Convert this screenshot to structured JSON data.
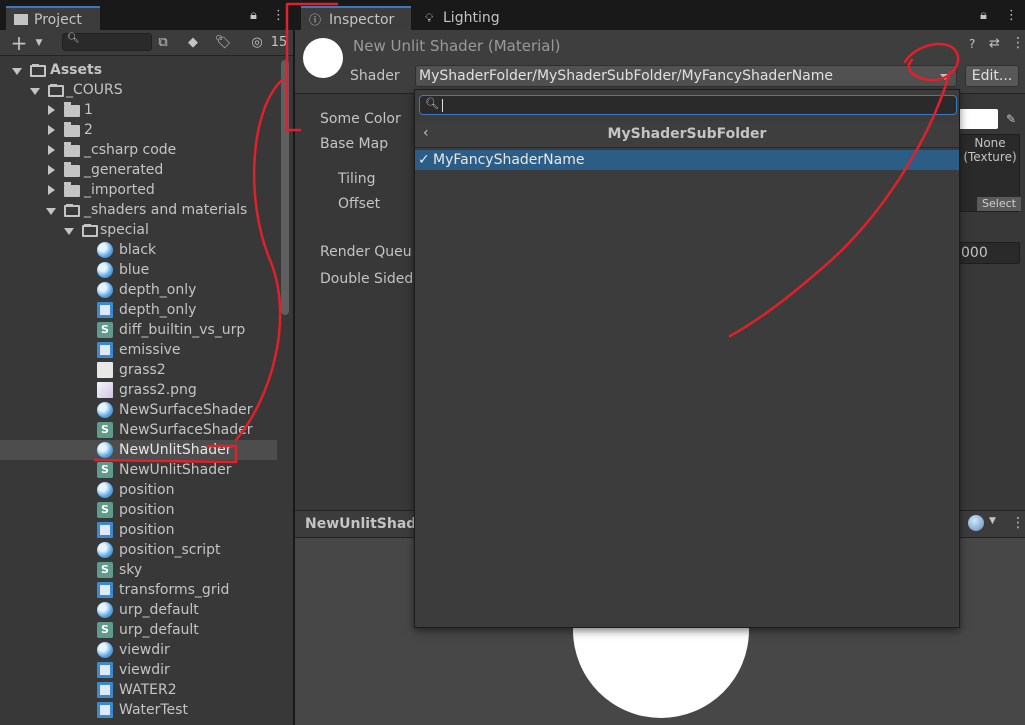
{
  "project_panel": {
    "tab_label": "Project",
    "search_placeholder": "",
    "hidden_count": "15",
    "tree": [
      {
        "label": "Assets",
        "icon": "folder-open-icon"
      },
      {
        "label": "_COURS",
        "icon": "folder-open-icon"
      },
      {
        "label": "1",
        "icon": "folder-icon"
      },
      {
        "label": "2",
        "icon": "folder-icon"
      },
      {
        "label": "_csharp code",
        "icon": "folder-icon"
      },
      {
        "label": "_generated",
        "icon": "folder-icon"
      },
      {
        "label": "_imported",
        "icon": "folder-icon"
      },
      {
        "label": "_shaders and materials",
        "icon": "folder-open-icon"
      },
      {
        "label": "special",
        "icon": "folder-open-icon"
      },
      {
        "label": "black",
        "icon": "material-icon"
      },
      {
        "label": "blue",
        "icon": "material-icon"
      },
      {
        "label": "depth_only",
        "icon": "material-icon"
      },
      {
        "label": "depth_only",
        "icon": "shader-graph-icon"
      },
      {
        "label": "diff_builtin_vs_urp",
        "icon": "shader-icon"
      },
      {
        "label": "emissive",
        "icon": "shader-graph-icon"
      },
      {
        "label": "grass2",
        "icon": "texture-icon"
      },
      {
        "label": "grass2.png",
        "icon": "texture-icon"
      },
      {
        "label": "NewSurfaceShader",
        "icon": "material-icon"
      },
      {
        "label": "NewSurfaceShader",
        "icon": "shader-icon"
      },
      {
        "label": "NewUnlitShader",
        "icon": "material-icon"
      },
      {
        "label": "NewUnlitShader",
        "icon": "shader-icon"
      },
      {
        "label": "position",
        "icon": "material-icon"
      },
      {
        "label": "position",
        "icon": "shader-icon"
      },
      {
        "label": "position",
        "icon": "shader-graph-icon"
      },
      {
        "label": "position_script",
        "icon": "material-icon"
      },
      {
        "label": "sky",
        "icon": "shader-icon"
      },
      {
        "label": "transforms_grid",
        "icon": "shader-graph-icon"
      },
      {
        "label": "urp_default",
        "icon": "material-icon"
      },
      {
        "label": "urp_default",
        "icon": "shader-icon"
      },
      {
        "label": "viewdir",
        "icon": "material-icon"
      },
      {
        "label": "viewdir",
        "icon": "shader-graph-icon"
      },
      {
        "label": "WATER2",
        "icon": "shader-graph-icon"
      },
      {
        "label": "WaterTest",
        "icon": "shader-graph-icon"
      }
    ]
  },
  "inspector": {
    "tab_inspector": "Inspector",
    "tab_lighting": "Lighting",
    "title": "New Unlit Shader (Material)",
    "shader_label": "Shader",
    "shader_value": "MyShaderFolder/MyShaderSubFolder/MyFancyShaderName",
    "edit_label": "Edit...",
    "properties": {
      "some_color": "Some Color",
      "base_map": "Base Map",
      "tiling": "Tiling",
      "offset": "Offset",
      "render_queue": "Render Queu",
      "double_sided": "Double Sided"
    },
    "texture_none_line1": "None",
    "texture_none_line2": "(Texture)",
    "texture_select": "Select",
    "render_queue_value": "000",
    "preview_name": "NewUnlitShade"
  },
  "shader_popup": {
    "search_value": "",
    "folder_title": "MyShaderSubFolder",
    "items": [
      {
        "label": "MyFancyShaderName",
        "checked": "✓"
      }
    ]
  },
  "colors": {
    "selection": "#2c5d87",
    "accent": "#3a79bb",
    "annotation": "#e0202a"
  }
}
